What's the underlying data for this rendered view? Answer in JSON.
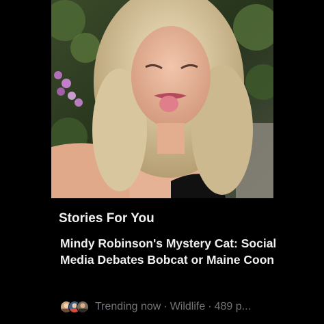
{
  "colors": {
    "background": "#000000",
    "primary_text": "#eef0f2",
    "secondary_text": "#71767b"
  },
  "section": {
    "heading": "Stories For You"
  },
  "story": {
    "image_alt": "Selfie of a woman with curly blonde hair sticking out her tongue, with flowers and foliage behind her",
    "headline": "Mindy Robinson's Mystery Cat: Social Media Debates Bobcat or Maine Coon",
    "avatars": [
      "avatar",
      "avatar",
      "avatar"
    ],
    "meta": {
      "status": "Trending now",
      "separator": "·",
      "category": "Wildlife",
      "count": "489 p..."
    }
  }
}
